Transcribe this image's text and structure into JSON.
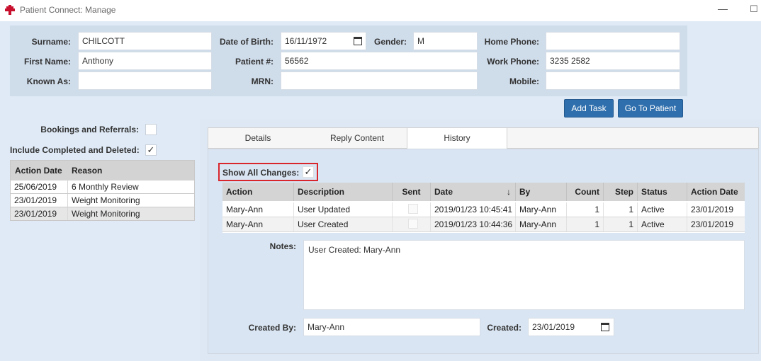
{
  "window": {
    "title": "Patient Connect: Manage",
    "minimize": "—",
    "maximize": "☐"
  },
  "patient": {
    "surname_label": "Surname:",
    "surname": "CHILCOTT",
    "first_name_label": "First Name:",
    "first_name": "Anthony",
    "known_as_label": "Known As:",
    "known_as": "",
    "dob_label": "Date of Birth:",
    "dob": "16/11/1972",
    "gender_label": "Gender:",
    "gender": "M",
    "patient_no_label": "Patient #:",
    "patient_no": "56562",
    "mrn_label": "MRN:",
    "mrn": "",
    "home_phone_label": "Home Phone:",
    "home_phone": "",
    "work_phone_label": "Work Phone:",
    "work_phone": "3235 2582",
    "mobile_label": "Mobile:",
    "mobile": ""
  },
  "actions": {
    "add_task": "Add Task",
    "go_to_patient": "Go To Patient"
  },
  "filters": {
    "bookings_label": "Bookings and Referrals:",
    "bookings_checked": false,
    "include_completed_label": "Include Completed and Deleted:",
    "include_completed_checked": true,
    "check_glyph": "✓"
  },
  "tasks": {
    "columns": [
      "Action Date",
      "Reason"
    ],
    "rows": [
      {
        "date": "25/06/2019",
        "reason": "6 Monthly Review",
        "struck": false
      },
      {
        "date": "23/01/2019",
        "reason": "Weight Monitoring",
        "struck": true
      },
      {
        "date": "23/01/2019",
        "reason": "Weight Monitoring",
        "struck": false,
        "selected": true
      }
    ]
  },
  "tabs": [
    {
      "label": "Details",
      "active": false
    },
    {
      "label": "Reply Content",
      "active": false
    },
    {
      "label": "History",
      "active": true
    }
  ],
  "history": {
    "show_all_label": "Show All Changes:",
    "show_all_checked": true,
    "sort_arrow": "↓",
    "columns": [
      "Action",
      "Description",
      "Sent",
      "Date",
      "By",
      "Count",
      "Step",
      "Status",
      "Action Date"
    ],
    "rows": [
      {
        "action": "Mary-Ann",
        "description": "User Updated",
        "date": "2019/01/23 10:45:41",
        "by": "Mary-Ann",
        "count": "1",
        "step": "1",
        "status": "Active",
        "action_date": "23/01/2019"
      },
      {
        "action": "Mary-Ann",
        "description": "User Created",
        "date": "2019/01/23 10:44:36",
        "by": "Mary-Ann",
        "count": "1",
        "step": "1",
        "status": "Active",
        "action_date": "23/01/2019"
      }
    ],
    "notes_label": "Notes:",
    "notes": "User Created: Mary-Ann",
    "created_by_label": "Created By:",
    "created_by": "Mary-Ann",
    "created_label": "Created:",
    "created": "23/01/2019"
  },
  "colors": {
    "accent_button": "#2f6fad",
    "highlight_border": "#d9262c",
    "logo_red": "#c8102e"
  }
}
